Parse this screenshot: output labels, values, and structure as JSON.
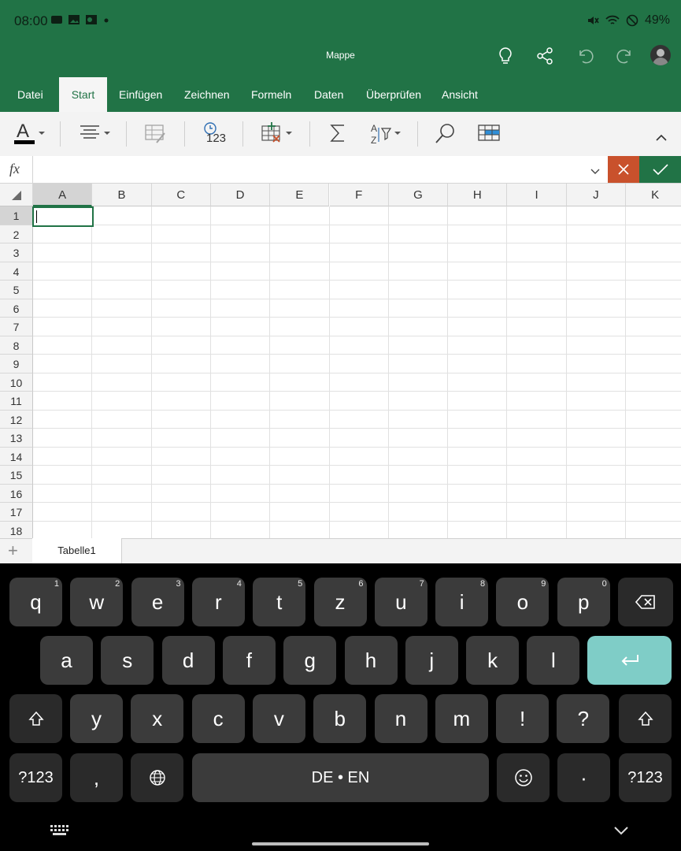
{
  "status": {
    "time": "08:00",
    "battery": "49%"
  },
  "title": "Mappe",
  "tabs": [
    "Datei",
    "Start",
    "Einfügen",
    "Zeichnen",
    "Formeln",
    "Daten",
    "Überprüfen",
    "Ansicht"
  ],
  "active_tab": "Start",
  "formula_bar": {
    "fx_label": "fx",
    "value": ""
  },
  "columns": [
    "A",
    "B",
    "C",
    "D",
    "E",
    "F",
    "G",
    "H",
    "I",
    "J",
    "K"
  ],
  "rows": [
    "1",
    "2",
    "3",
    "4",
    "5",
    "6",
    "7",
    "8",
    "9",
    "10",
    "11",
    "12",
    "13",
    "14",
    "15",
    "16",
    "17",
    "18"
  ],
  "selected_cell": "A1",
  "sheet": {
    "add_label": "+",
    "tab_label": "Tabelle1"
  },
  "toolbar": {
    "number_format_label": "123"
  },
  "keyboard": {
    "row1": [
      {
        "k": "q",
        "s": "1"
      },
      {
        "k": "w",
        "s": "2"
      },
      {
        "k": "e",
        "s": "3"
      },
      {
        "k": "r",
        "s": "4"
      },
      {
        "k": "t",
        "s": "5"
      },
      {
        "k": "z",
        "s": "6"
      },
      {
        "k": "u",
        "s": "7"
      },
      {
        "k": "i",
        "s": "8"
      },
      {
        "k": "o",
        "s": "9"
      },
      {
        "k": "p",
        "s": "0"
      }
    ],
    "row2": [
      "a",
      "s",
      "d",
      "f",
      "g",
      "h",
      "j",
      "k",
      "l"
    ],
    "row3": [
      "y",
      "x",
      "c",
      "v",
      "b",
      "n",
      "m",
      "!",
      "?"
    ],
    "symbols_label": "?123",
    "comma": ",",
    "space_label": "DE • EN",
    "period": "·"
  },
  "colors": {
    "brand": "#217346",
    "cancel": "#c9512c",
    "enter": "#7fcdc7"
  }
}
